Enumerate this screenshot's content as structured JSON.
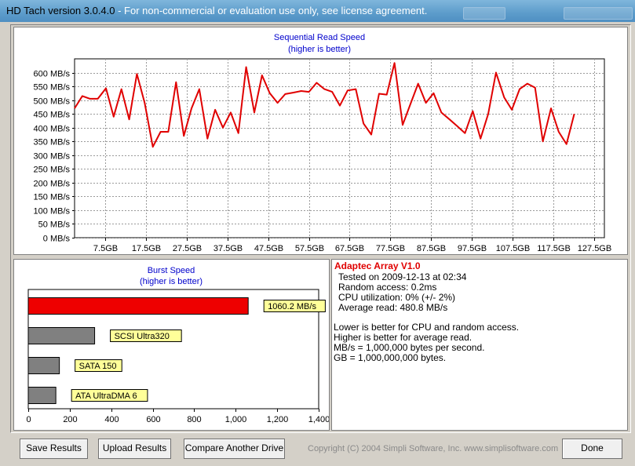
{
  "window": {
    "title_prefix": "HD Tach version 3.0.4.0",
    "title_warning": " - For non-commercial or evaluation use only, see license agreement."
  },
  "sequential": {
    "title": "Sequential Read Speed",
    "subtitle": "(higher is better)"
  },
  "burst": {
    "title": "Burst Speed",
    "subtitle": "(higher is better)"
  },
  "info": {
    "drive_name": "Adaptec Array V1.0",
    "tested_on": "Tested on 2009-12-13 at 02:34",
    "random_access": "Random access: 0.2ms",
    "cpu_utilization": "CPU utilization: 0% (+/- 2%)",
    "average_read": "Average read: 480.8 MB/s",
    "note1": "Lower is better for CPU and random access.",
    "note2": "Higher is better for average read.",
    "note3": "MB/s = 1,000,000 bytes per second.",
    "note4": "GB = 1,000,000,000 bytes."
  },
  "buttons": {
    "save": "Save Results",
    "upload": "Upload Results",
    "compare": "Compare Another Drive",
    "done": "Done"
  },
  "copyright": "Copyright (C) 2004 Simpli Software, Inc. www.simplisoftware.com",
  "colors": {
    "line": "#e00000",
    "bar_primary": "#ee0000",
    "bar_other": "#808080",
    "label_bg": "#ffff99"
  },
  "chart_data": [
    {
      "type": "line",
      "title": "Sequential Read Speed",
      "subtitle": "(higher is better)",
      "ylim": [
        0,
        650
      ],
      "xlim": [
        0,
        130
      ],
      "yticks": [
        0,
        50,
        100,
        150,
        200,
        250,
        300,
        350,
        400,
        450,
        500,
        550,
        600
      ],
      "ytick_labels": [
        "0 MB/s",
        "50 MB/s",
        "100 MB/s",
        "150 MB/s",
        "200 MB/s",
        "250 MB/s",
        "300 MB/s",
        "350 MB/s",
        "400 MB/s",
        "450 MB/s",
        "500 MB/s",
        "550 MB/s",
        "600 MB/s"
      ],
      "xticks": [
        7.5,
        17.5,
        27.5,
        37.5,
        47.5,
        57.5,
        67.5,
        77.5,
        87.5,
        97.5,
        107.5,
        117.5,
        127.5
      ],
      "xtick_labels": [
        "7.5GB",
        "17.5GB",
        "27.5GB",
        "37.5GB",
        "47.5GB",
        "57.5GB",
        "67.5GB",
        "77.5GB",
        "87.5GB",
        "97.5GB",
        "107.5GB",
        "117.5GB",
        "127.5GB"
      ],
      "grid": true,
      "x": [
        0,
        1.9,
        3.8,
        5.7,
        7.7,
        9.6,
        11.5,
        13.4,
        15.3,
        17.2,
        19.2,
        21.1,
        23.0,
        24.9,
        26.8,
        28.7,
        30.6,
        32.6,
        34.5,
        36.4,
        38.3,
        40.2,
        42.1,
        44.1,
        46.0,
        47.9,
        49.8,
        51.7,
        53.6,
        55.6,
        57.5,
        59.4,
        61.3,
        63.2,
        65.1,
        67.0,
        69.0,
        70.9,
        72.8,
        74.7,
        76.6,
        78.5,
        80.5,
        82.4,
        84.3,
        86.2,
        88.1,
        90.0,
        92.0,
        93.9,
        95.8,
        97.7,
        99.6,
        101.5,
        103.4,
        105.4,
        107.3,
        109.2,
        111.1,
        113.0,
        114.9,
        116.9,
        118.8,
        120.7,
        122.6,
        124.5,
        126.4,
        128.4,
        130.0
      ],
      "series": [
        {
          "values": [
            470,
            515,
            505,
            505,
            543,
            440,
            540,
            430,
            595,
            490,
            330,
            385,
            385,
            565,
            370,
            470,
            540,
            360,
            465,
            400,
            455,
            380,
            620,
            455,
            590,
            525,
            490,
            522,
            527,
            533,
            530,
            563,
            540,
            530,
            480,
            535,
            540,
            415,
            375,
            523,
            520,
            635,
            410,
            485,
            560,
            490,
            525,
            455,
            430,
            405,
            380,
            460,
            360,
            450,
            600,
            510,
            465,
            540,
            560,
            545,
            350,
            470,
            385,
            340,
            450
          ]
        }
      ]
    },
    {
      "type": "bar",
      "title": "Burst Speed",
      "subtitle": "(higher is better)",
      "orientation": "horizontal",
      "xlim": [
        0,
        1400
      ],
      "xticks": [
        0,
        200,
        400,
        600,
        800,
        1000,
        1200,
        1400
      ],
      "xtick_labels": [
        "0",
        "200",
        "400",
        "600",
        "800",
        "1,000",
        "1,200",
        "1,400"
      ],
      "categories": [
        "1060.2 MB/s",
        "SCSI Ultra320",
        "SATA 150",
        "ATA UltraDMA 6"
      ],
      "values": [
        1060.2,
        320,
        150,
        133
      ]
    }
  ]
}
